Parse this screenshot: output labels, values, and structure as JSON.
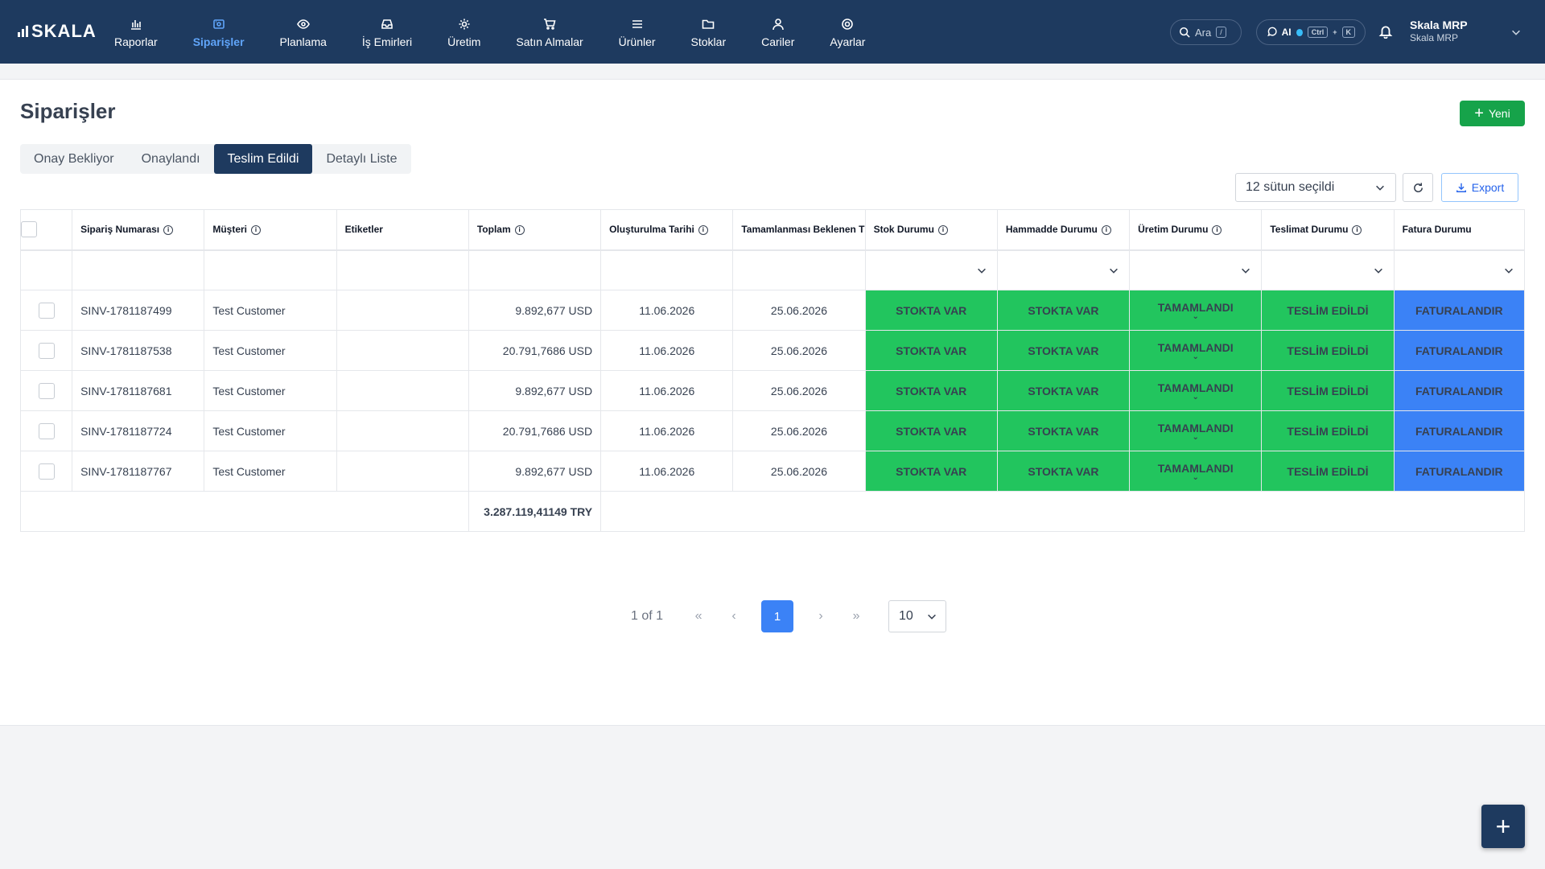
{
  "brand": {
    "name": "SKALA"
  },
  "nav": {
    "items": [
      {
        "label": "Raporlar",
        "icon": "chart-icon"
      },
      {
        "label": "Siparişler",
        "icon": "orders-icon",
        "active": true
      },
      {
        "label": "Planlama",
        "icon": "eye-icon"
      },
      {
        "label": "İş Emirleri",
        "icon": "inbox-icon"
      },
      {
        "label": "Üretim",
        "icon": "gear-icon"
      },
      {
        "label": "Satın Almalar",
        "icon": "cart-icon"
      },
      {
        "label": "Ürünler",
        "icon": "menu-icon"
      },
      {
        "label": "Stoklar",
        "icon": "folder-icon"
      },
      {
        "label": "Cariler",
        "icon": "user-icon"
      },
      {
        "label": "Ayarlar",
        "icon": "settings-icon"
      }
    ],
    "search_label": "Ara",
    "search_kbd": "/",
    "ai_label": "AI",
    "ai_kbd1": "Ctrl",
    "ai_kbd2": "K",
    "user_name": "Skala MRP",
    "user_company": "Skala MRP"
  },
  "page": {
    "title": "Siparişler",
    "new_button": "Yeni",
    "tabs": [
      {
        "label": "Onay Bekliyor"
      },
      {
        "label": "Onaylandı"
      },
      {
        "label": "Teslim Edildi",
        "active": true
      },
      {
        "label": "Detaylı Liste"
      }
    ],
    "column_select": "12 sütun seçildi",
    "export_label": "Export"
  },
  "table": {
    "headers": {
      "order": "Sipariş Numarası",
      "customer": "Müşteri",
      "tags": "Etiketler",
      "total": "Toplam",
      "created": "Oluşturulma Tarihi",
      "expected": "Tamamlanması Beklenen T",
      "stock": "Stok Durumu",
      "material": "Hammadde Durumu",
      "production": "Üretim Durumu",
      "delivery": "Teslimat Durumu",
      "invoice": "Fatura Durumu"
    },
    "rows": [
      {
        "order": "SINV-1781187499",
        "customer": "Test Customer",
        "tags": "",
        "total": "9.892,677 USD",
        "created": "11.06.2026",
        "expected": "25.06.2026",
        "stock": "STOKTA VAR",
        "material": "STOKTA VAR",
        "production": "TAMAMLANDI",
        "delivery": "TESLİM EDİLDİ",
        "invoice": "FATURALANDIR"
      },
      {
        "order": "SINV-1781187538",
        "customer": "Test Customer",
        "tags": "",
        "total": "20.791,7686 USD",
        "created": "11.06.2026",
        "expected": "25.06.2026",
        "stock": "STOKTA VAR",
        "material": "STOKTA VAR",
        "production": "TAMAMLANDI",
        "delivery": "TESLİM EDİLDİ",
        "invoice": "FATURALANDIR"
      },
      {
        "order": "SINV-1781187681",
        "customer": "Test Customer",
        "tags": "",
        "total": "9.892,677 USD",
        "created": "11.06.2026",
        "expected": "25.06.2026",
        "stock": "STOKTA VAR",
        "material": "STOKTA VAR",
        "production": "TAMAMLANDI",
        "delivery": "TESLİM EDİLDİ",
        "invoice": "FATURALANDIR"
      },
      {
        "order": "SINV-1781187724",
        "customer": "Test Customer",
        "tags": "",
        "total": "20.791,7686 USD",
        "created": "11.06.2026",
        "expected": "25.06.2026",
        "stock": "STOKTA VAR",
        "material": "STOKTA VAR",
        "production": "TAMAMLANDI",
        "delivery": "TESLİM EDİLDİ",
        "invoice": "FATURALANDIR"
      },
      {
        "order": "SINV-1781187767",
        "customer": "Test Customer",
        "tags": "",
        "total": "9.892,677 USD",
        "created": "11.06.2026",
        "expected": "25.06.2026",
        "stock": "STOKTA VAR",
        "material": "STOKTA VAR",
        "production": "TAMAMLANDI",
        "delivery": "TESLİM EDİLDİ",
        "invoice": "FATURALANDIR"
      }
    ],
    "grand_total": "3.287.119,41149 TRY"
  },
  "pagination": {
    "label": "1 of 1",
    "current": "1",
    "page_size": "10"
  },
  "colors": {
    "navbar": "#1e3a5f",
    "active_nav": "#60a5fa",
    "green_status": "#22c55e",
    "blue_status": "#3b82f6",
    "new_button": "#16a34a"
  }
}
